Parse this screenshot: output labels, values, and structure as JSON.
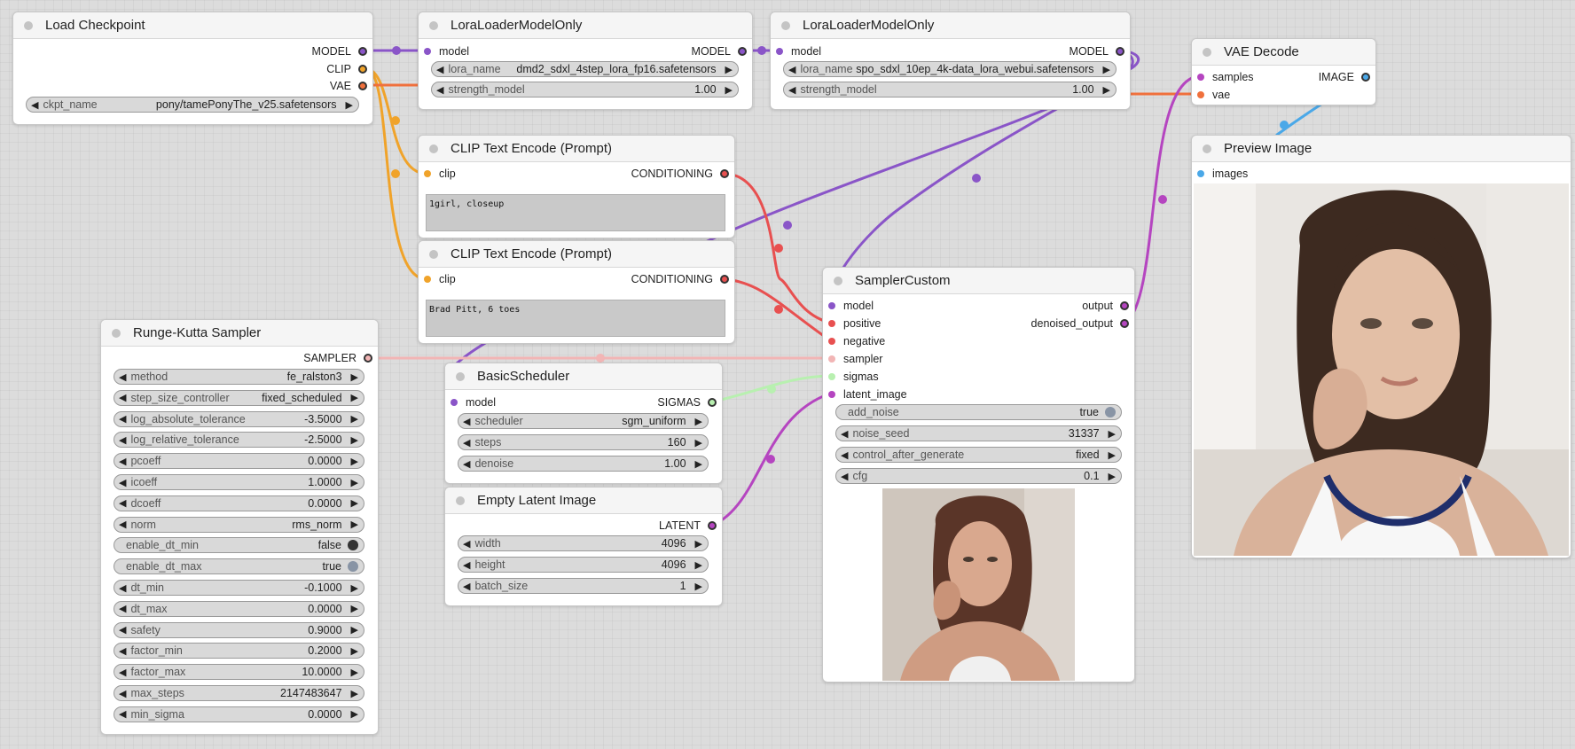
{
  "colors": {
    "model": "#8a55c8",
    "clip": "#f0a32a",
    "vae": "#f0703c",
    "conditioning": "#e85050",
    "sampler": "#f2b5b5",
    "sigmas": "#b8f0b0",
    "latent": "#b545c0",
    "image": "#4aa8e8"
  },
  "load_checkpoint": {
    "title": "Load Checkpoint",
    "outputs": [
      "MODEL",
      "CLIP",
      "VAE"
    ],
    "ckpt_name_label": "ckpt_name",
    "ckpt_name_value": "pony/tamePonyThe_v25.safetensors"
  },
  "lora1": {
    "title": "LoraLoaderModelOnly",
    "input_model": "model",
    "output_model": "MODEL",
    "lora_name_label": "lora_name",
    "lora_name_value": "dmd2_sdxl_4step_lora_fp16.safetensors",
    "strength_label": "strength_model",
    "strength_value": "1.00"
  },
  "lora2": {
    "title": "LoraLoaderModelOnly",
    "input_model": "model",
    "output_model": "MODEL",
    "lora_name_label": "lora_name",
    "lora_name_value": "spo_sdxl_10ep_4k-data_lora_webui.safetensors",
    "strength_label": "strength_model",
    "strength_value": "1.00"
  },
  "vae_decode": {
    "title": "VAE Decode",
    "input_samples": "samples",
    "input_vae": "vae",
    "output_image": "IMAGE"
  },
  "preview_image": {
    "title": "Preview Image",
    "input_images": "images"
  },
  "clip_pos": {
    "title": "CLIP Text Encode (Prompt)",
    "input_clip": "clip",
    "output": "CONDITIONING",
    "text": "1girl, closeup"
  },
  "clip_neg": {
    "title": "CLIP Text Encode (Prompt)",
    "input_clip": "clip",
    "output": "CONDITIONING",
    "text": "Brad Pitt, 6 toes"
  },
  "sampler_custom": {
    "title": "SamplerCustom",
    "inputs": [
      "model",
      "positive",
      "negative",
      "sampler",
      "sigmas",
      "latent_image"
    ],
    "outputs": [
      "output",
      "denoised_output"
    ],
    "widgets": [
      {
        "name": "add_noise",
        "value": "true"
      },
      {
        "name": "noise_seed",
        "value": "31337"
      },
      {
        "name": "control_after_generate",
        "value": "fixed"
      },
      {
        "name": "cfg",
        "value": "0.1"
      }
    ]
  },
  "rk_sampler": {
    "title": "Runge-Kutta Sampler",
    "output": "SAMPLER",
    "widgets": [
      {
        "name": "method",
        "value": "fe_ralston3"
      },
      {
        "name": "step_size_controller",
        "value": "fixed_scheduled"
      },
      {
        "name": "log_absolute_tolerance",
        "value": "-3.5000"
      },
      {
        "name": "log_relative_tolerance",
        "value": "-2.5000"
      },
      {
        "name": "pcoeff",
        "value": "0.0000"
      },
      {
        "name": "icoeff",
        "value": "1.0000"
      },
      {
        "name": "dcoeff",
        "value": "0.0000"
      },
      {
        "name": "norm",
        "value": "rms_norm"
      },
      {
        "name": "enable_dt_min",
        "value": "false"
      },
      {
        "name": "enable_dt_max",
        "value": "true"
      },
      {
        "name": "dt_min",
        "value": "-0.1000"
      },
      {
        "name": "dt_max",
        "value": "0.0000"
      },
      {
        "name": "safety",
        "value": "0.9000"
      },
      {
        "name": "factor_min",
        "value": "0.2000"
      },
      {
        "name": "factor_max",
        "value": "10.0000"
      },
      {
        "name": "max_steps",
        "value": "2147483647"
      },
      {
        "name": "min_sigma",
        "value": "0.0000"
      }
    ]
  },
  "basic_scheduler": {
    "title": "BasicScheduler",
    "input_model": "model",
    "output": "SIGMAS",
    "widgets": [
      {
        "name": "scheduler",
        "value": "sgm_uniform"
      },
      {
        "name": "steps",
        "value": "160"
      },
      {
        "name": "denoise",
        "value": "1.00"
      }
    ]
  },
  "empty_latent": {
    "title": "Empty Latent Image",
    "output": "LATENT",
    "widgets": [
      {
        "name": "width",
        "value": "4096"
      },
      {
        "name": "height",
        "value": "4096"
      },
      {
        "name": "batch_size",
        "value": "1"
      }
    ]
  }
}
